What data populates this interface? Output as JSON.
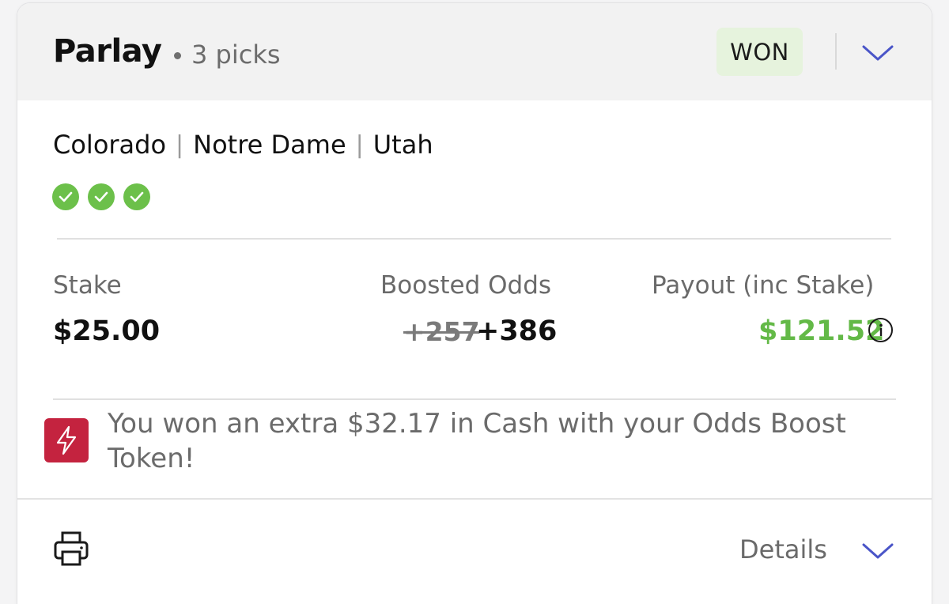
{
  "bet": {
    "type": "Parlay",
    "picks_label": "3 picks",
    "status": "WON"
  },
  "legs": [
    {
      "team": "Colorado",
      "result": "won"
    },
    {
      "team": "Notre Dame",
      "result": "won"
    },
    {
      "team": "Utah",
      "result": "won"
    }
  ],
  "summary": {
    "stake_label": "Stake",
    "stake_value": "$25.00",
    "odds_label": "Boosted Odds",
    "odds_original": "+257",
    "odds_boosted": "+386",
    "payout_label": "Payout (inc Stake)",
    "payout_value": "$121.52"
  },
  "boost_message": "You won an extra $32.17 in Cash with your Odds Boost Token!",
  "footer": {
    "details_label": "Details"
  },
  "icons": {
    "expand": "chevron-down-icon",
    "leg_status": "check-circle-icon",
    "info": "info-icon",
    "boost": "lightning-icon",
    "print": "printer-icon"
  },
  "colors": {
    "won_badge_bg": "#e6f3dd",
    "check_green": "#6cc04a",
    "payout_green": "#63b947",
    "boost_red": "#c4233f",
    "chevron_blue": "#4a55c8"
  }
}
